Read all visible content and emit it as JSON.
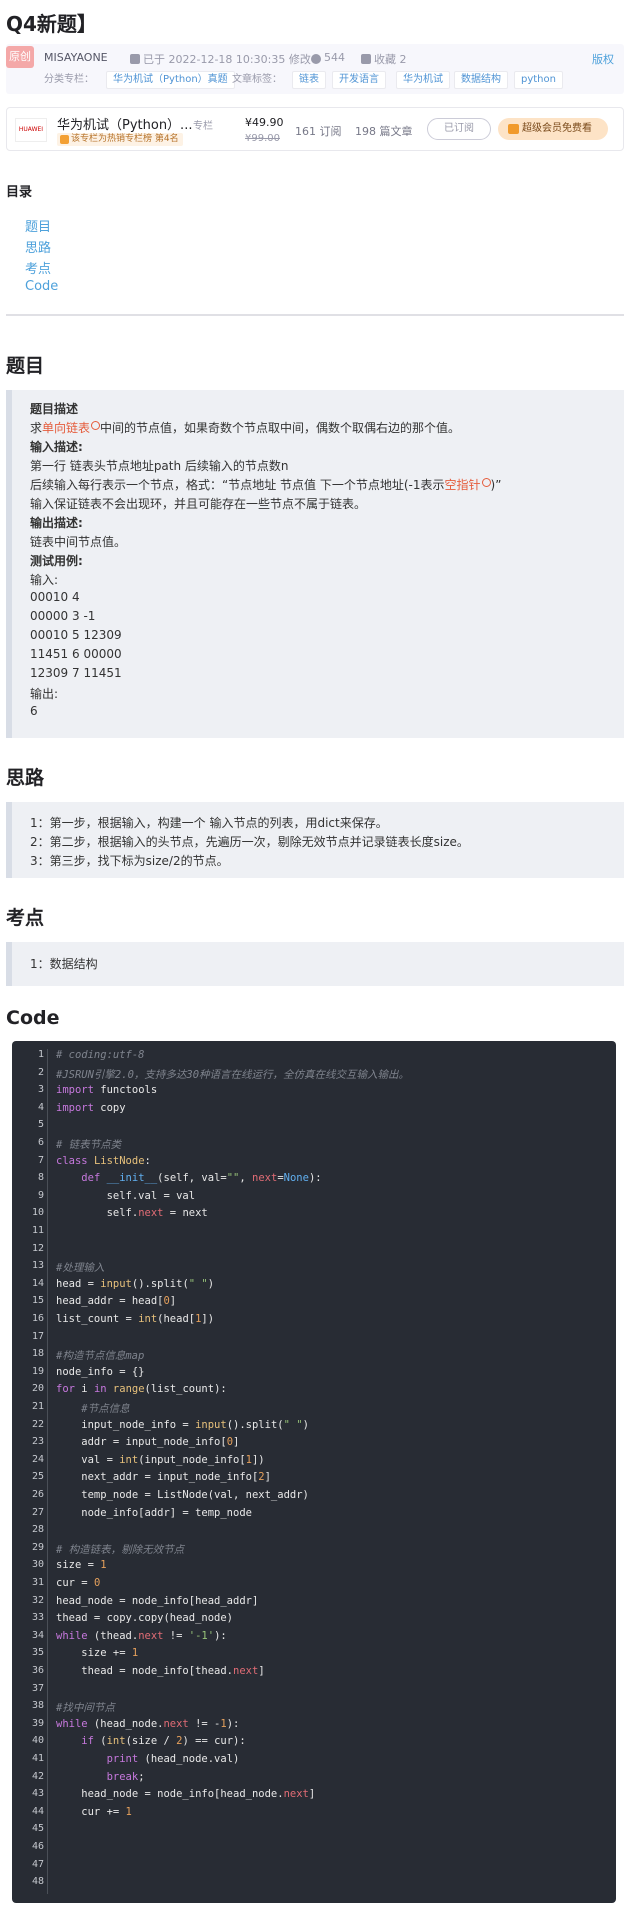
{
  "article": {
    "title": "Q4新题】",
    "original_badge": "原创",
    "author": "MISAYAONE",
    "time": "已于 2022-12-18 10:30:35 修改",
    "views": "544",
    "favorites": "收藏 2",
    "copyright": "版权",
    "column_label": "分类专栏：",
    "column_tag": "华为机试（Python）真题",
    "tags_label": "文章标签：",
    "tags": [
      "链表",
      "开发语言",
      "华为机试",
      "数据结构",
      "python"
    ]
  },
  "column_card": {
    "logo_text": "HUAWEI",
    "name": "华为机试（Python）...",
    "name_suffix": "专栏",
    "rank": "该专栏为热销专栏榜 第4名",
    "price": "¥49.90",
    "old_price": "¥99.00",
    "subscribers": "161 订阅",
    "articles": "198 篇文章",
    "subscribe_button": "已订阅",
    "vip_button": "超级会员免费看"
  },
  "toc": {
    "title": "目录",
    "items": [
      "题目",
      "思路",
      "考点",
      "Code"
    ]
  },
  "sections": {
    "problem_heading": "题目",
    "idea_heading": "思路",
    "points_heading": "考点",
    "code_heading": "Code"
  },
  "problem": {
    "desc_label": "题目描述",
    "desc_pre": "求",
    "desc_link": "单向链表",
    "desc_post": "中间的节点值，如果奇数个节点取中间，偶数个取偶右边的那个值。",
    "input_label": "输入描述:",
    "input_line1": "第一行 链表头节点地址path 后续输入的节点数n",
    "input_line2_pre": "后续输入每行表示一个节点，格式：“节点地址 节点值 下一个节点地址(-1表示",
    "input_line2_link": "空指针",
    "input_line2_post": ")”",
    "input_line3": "输入保证链表不会出现环，并且可能存在一些节点不属于链表。",
    "output_label": "输出描述:",
    "output_line": "链表中间节点值。",
    "example_label": "测试用例:",
    "example_input_label": "输入:",
    "example_lines": [
      "00010 4",
      "00000 3 -1",
      "00010 5 12309",
      "11451 6 00000",
      "12309 7 11451"
    ],
    "example_output_label": "输出:",
    "example_output": "6"
  },
  "ideas": [
    "1：第一步，根据输入，构建一个 输入节点的列表，用dict来保存。",
    "2：第二步，根据输入的头节点，先遍历一次，剔除无效节点并记录链表长度size。",
    "3：第三步，找下标为size/2的节点。"
  ],
  "points": [
    "1：数据结构"
  ],
  "code_lines": [
    "# coding:utf-8",
    "#JSRUN引擎2.0，支持多达30种语言在线运行，全仿真在线交互输入输出。",
    "import functools",
    "import copy",
    "",
    "# 链表节点类",
    "class ListNode:",
    "    def __init__(self, val=\"\", next=None):",
    "        self.val = val",
    "        self.next = next",
    "",
    "",
    "#处理输入",
    "head = input().split(\" \")",
    "head_addr = head[0]",
    "list_count = int(head[1])",
    "",
    "#构造节点信息map",
    "node_info = {}",
    "for i in range(list_count):",
    "    #节点信息",
    "    input_node_info = input().split(\" \")",
    "    addr = input_node_info[0]",
    "    val = int(input_node_info[1])",
    "    next_addr = input_node_info[2]",
    "    temp_node = ListNode(val, next_addr)",
    "    node_info[addr] = temp_node",
    "",
    "# 构造链表，剔除无效节点",
    "size = 1",
    "cur = 0",
    "head_node = node_info[head_addr]",
    "thead = copy.copy(head_node)",
    "while (thead.next != '-1'):",
    "    size += 1",
    "    thead = node_info[thead.next]",
    "",
    "#找中间节点",
    "while (head_node.next != -1):",
    "    if (int(size / 2) == cur):",
    "        print (head_node.val)",
    "        break;",
    "    head_node = node_info[head_node.next]",
    "    cur += 1",
    "",
    "",
    "",
    ""
  ]
}
